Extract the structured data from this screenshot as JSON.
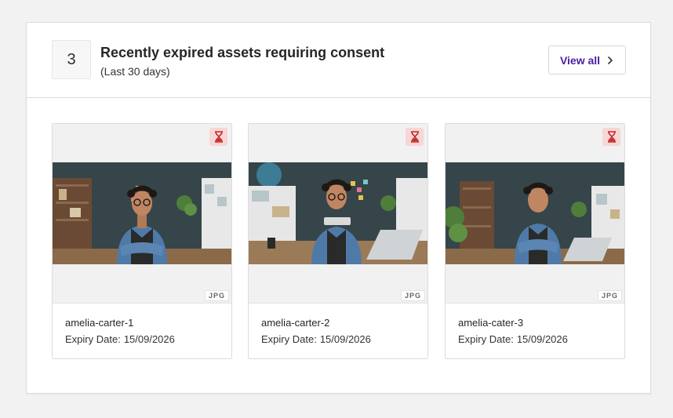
{
  "header": {
    "count": "3",
    "title": "Recently expired assets requiring consent",
    "subtitle": "(Last 30 days)",
    "view_all_label": "View all"
  },
  "colors": {
    "accent": "#4a1fa0",
    "badge_bg": "#f7d6d6",
    "badge_icon": "#c62828"
  },
  "cards": [
    {
      "name": "amelia-carter-1",
      "expiry_label": "Expiry Date:",
      "expiry_date": "15/09/2026",
      "file_type": "JPG",
      "status_icon": "hourglass-icon"
    },
    {
      "name": "amelia-carter-2",
      "expiry_label": "Expiry Date:",
      "expiry_date": "15/09/2026",
      "file_type": "JPG",
      "status_icon": "hourglass-icon"
    },
    {
      "name": "amelia-cater-3",
      "expiry_label": "Expiry Date:",
      "expiry_date": "15/09/2026",
      "file_type": "JPG",
      "status_icon": "hourglass-icon"
    }
  ]
}
